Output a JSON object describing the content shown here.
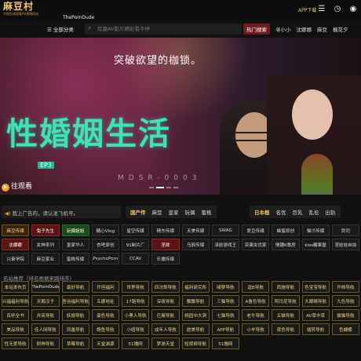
{
  "header": {
    "logo_text": "麻豆村",
    "logo_sub": "中国在线观看AV视频网站",
    "site_name": "ThePornDude",
    "app_download": "APP下载"
  },
  "nav": {
    "all_categories": "全部分类",
    "search_placeholder": "有趣AV影片精彩看不停",
    "links": [
      "热门搜索",
      "寻小小",
      "沈娜娜",
      "麻豆",
      "楓花夕"
    ]
  },
  "banner": {
    "slogan": "突破欲望的枷锁。",
    "title": "性婚姻生活",
    "ep": "EP3",
    "code": "MDSR-0003",
    "watch_label": "往观看"
  },
  "filterbar": {
    "ad_text": "我上广告的，请认准飞机号。",
    "domestic": {
      "label": "国产传",
      "items": [
        "麻豆",
        "皇家",
        "玩偶",
        "蜜桃"
      ]
    },
    "japanese": {
      "label": "日本棍",
      "items": [
        "名优",
        "巨乳",
        "乱伦",
        "出轨"
      ]
    }
  },
  "tag_rows": [
    [
      {
        "t": "麻豆传媒",
        "c": "hl"
      },
      {
        "t": "兔子先生",
        "c": "red"
      },
      {
        "t": "玩偶姐姐",
        "c": "grn"
      },
      {
        "t": "糖心Vlog"
      },
      {
        "t": "星空传媒"
      },
      {
        "t": "精东传媒"
      },
      {
        "t": "天美传媒"
      },
      {
        "t": "SWAG"
      },
      {
        "t": "爱豆传媒"
      },
      {
        "t": "蜂蜜原创"
      },
      {
        "t": "猫爪传媒"
      },
      {
        "t": "剑司"
      }
    ],
    [
      {
        "t": "沈娜娜",
        "c": "red"
      },
      {
        "t": "女神系列"
      },
      {
        "t": "皇家华人"
      },
      {
        "t": "杏吧原创"
      },
      {
        "t": "91制片厂"
      },
      {
        "t": "淫欲",
        "c": "red"
      },
      {
        "t": "乌鸦传媒"
      },
      {
        "t": "泽欧游戏王"
      },
      {
        "t": "突袭女优家"
      },
      {
        "t": "情趣K歌房"
      },
      {
        "t": "kiss糖果屋"
      },
      {
        "t": "淫娃娃自拍"
      }
    ],
    [
      {
        "t": "兴奋学院"
      },
      {
        "t": "麻豆家业"
      },
      {
        "t": "蜜桃传媒"
      },
      {
        "t": "PsychoPorn"
      },
      {
        "t": "CCAV"
      },
      {
        "t": "乐播传媒"
      }
    ]
  ],
  "section_label": "名站推荐（排名根据来路排序）",
  "site_rows": [
    [
      "本站发布页",
      "ThePornDude",
      "最好导航",
      "开坦福利",
      "世界导航",
      "四次郎导航",
      "福利研究所",
      "啵萝导航",
      "逗B导航",
      "西施导航",
      "色宝宝导航",
      "开档导航"
    ],
    [
      "兴福福利导航",
      "天鹅汉子",
      "吾谷福利导航",
      "五挪地址",
      "17路导航",
      "深夜导航",
      "飘飘导航",
      "三猫导航",
      "A鲁色导航",
      "阿玛尼导航",
      "大眼睛导航",
      "九色导航"
    ],
    [
      "百杯全书",
      "井亮导航",
      "妖娆导航",
      "姿色导航",
      "小黑人导航",
      "巨屌导航",
      "桃园中大洞",
      "七猫导航",
      "老牛导航",
      "五猫导航",
      "AV草中草",
      "猫猫导航"
    ],
    [
      "美品导航",
      "佳人网导航",
      "凤凰导航",
      "鲍鱼导航",
      "小妞导航",
      "成年人导航",
      "欧美导航",
      "APP导航",
      "小羊导航",
      "夜色导航",
      "插转导航",
      "色蝴蝶"
    ],
    [
      "性无爱导航",
      "财神导航",
      "草莓导航",
      "天堂渊源",
      "51撸网",
      "梦游天堂",
      "短视频导航",
      "51撸网"
    ]
  ],
  "colors": {
    "accent": "#f0c060",
    "background": "#111111",
    "tag_highlight": "#3a2408"
  }
}
